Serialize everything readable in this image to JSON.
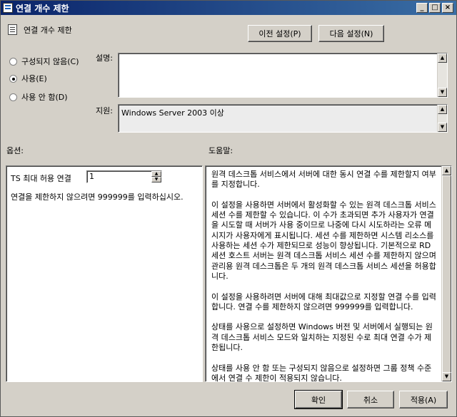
{
  "window": {
    "title": "연결 개수 제한"
  },
  "header": {
    "title": "연결 개수 제한",
    "prev_button": "이전 설정(P)",
    "next_button": "다음 설정(N)"
  },
  "state_options": [
    {
      "label": "구성되지 않음(C)",
      "checked": false
    },
    {
      "label": "사용(E)",
      "checked": true
    },
    {
      "label": "사용 안 함(D)",
      "checked": false
    }
  ],
  "comment": {
    "label": "설명:",
    "value": ""
  },
  "supported": {
    "label": "지원:",
    "value": "Windows Server 2003 이상"
  },
  "options": {
    "label": "옵션:",
    "field_label": "TS 최대 허용 연결",
    "field_value": "1",
    "note": "연결을 제한하지 않으려면 999999를 입력하십시오."
  },
  "help": {
    "label": "도움말:",
    "text": "원격 데스크톱 서비스에서 서버에 대한 동시 연결 수를 제한할지 여부를 지정합니다.\n\n이 설정을 사용하면 서버에서 활성화할 수 있는 원격 데스크톱 서비스 세션 수를 제한할 수 있습니다. 이 수가 초과되면 추가 사용자가 연결을 시도할 때 서버가 사용 중이므로 나중에 다시 시도하라는 오류 메시지가 사용자에게 표시됩니다. 세션 수를 제한하면 시스템 리소스를 사용하는 세션 수가 제한되므로 성능이 향상됩니다. 기본적으로 RD 세션 호스트 서버는 원격 데스크톱 서비스 세션 수를 제한하지 않으며 관리용 원격 데스크톱은 두 개의 원격 데스크톱 서비스 세션을 허용합니다.\n\n이 설정을 사용하려면 서버에 대해 최대값으로 지정할 연결 수를 입력합니다. 연결 수를 제한하지 않으려면 999999를 입력합니다.\n\n상태를 사용으로 설정하면 Windows 버전 및 서버에서 실행되는 원격 데스크톱 서비스 모드와 일치하는 지정된 수로 최대 연결 수가 제한됩니다.\n\n상태를 사용 안 함 또는 구성되지 않음으로 설정하면 그룹 정책 수준에서 연결 수 제한이 적용되지 않습니다."
  },
  "footer": {
    "ok": "확인",
    "cancel": "취소",
    "apply": "적용(A)"
  }
}
